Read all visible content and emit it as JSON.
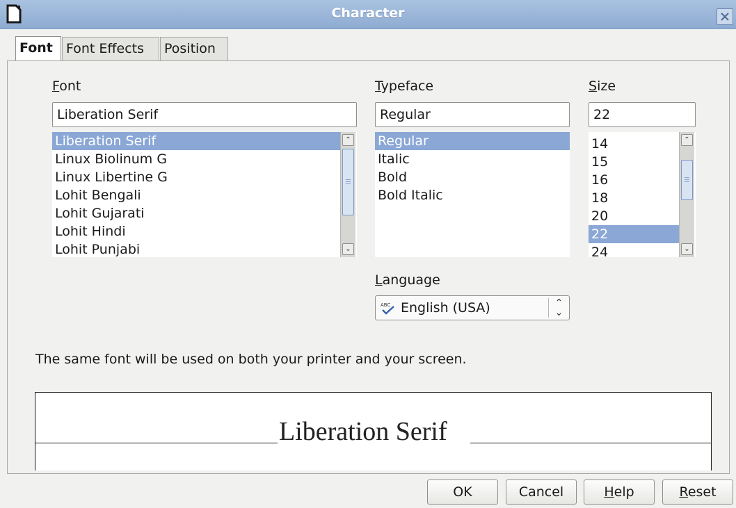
{
  "window": {
    "title": "Character"
  },
  "tabs": [
    {
      "label": "Font"
    },
    {
      "label": "Font Effects"
    },
    {
      "label": "Position"
    }
  ],
  "font": {
    "label_access": "F",
    "label_rest": "ont",
    "value": "Liberation Serif",
    "items": [
      "Liberation Serif",
      "Linux Biolinum G",
      "Linux Libertine G",
      "Lohit Bengali",
      "Lohit Gujarati",
      "Lohit Hindi",
      "Lohit Punjabi"
    ],
    "selected": "Liberation Serif"
  },
  "typeface": {
    "label_access": "T",
    "label_rest": "ypeface",
    "value": "Regular",
    "items": [
      "Regular",
      "Italic",
      "Bold",
      "Bold Italic"
    ],
    "selected": "Regular"
  },
  "size": {
    "label_access": "S",
    "label_rest": "ize",
    "value": "22",
    "items": [
      "14",
      "15",
      "16",
      "18",
      "20",
      "22",
      "24"
    ],
    "selected": "22"
  },
  "language": {
    "label_access": "L",
    "label_rest": "anguage",
    "value": "English (USA)",
    "icon": "spellcheck-icon"
  },
  "note": "The same font will be used on both your printer and your screen.",
  "preview": {
    "text": "Liberation Serif"
  },
  "buttons": {
    "ok": "OK",
    "cancel": "Cancel",
    "help_access": "H",
    "help_rest": "elp",
    "reset_access": "R",
    "reset_rest": "eset"
  },
  "colors": {
    "titlebar": "#8eabd2",
    "selection": "#8aa7d6",
    "background": "#f1f1ef"
  }
}
